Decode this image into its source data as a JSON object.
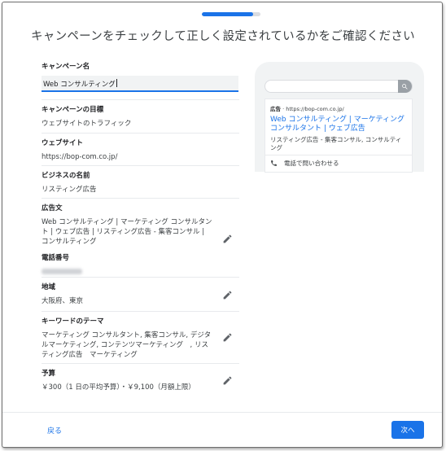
{
  "progress": {
    "completed_fraction": 0.88
  },
  "page_title": "キャンペーンをチェックして正しく設定されているかをご確認ください",
  "campaign_name": {
    "label": "キャンペーン名",
    "value": "Web コンサルティング"
  },
  "sections": {
    "goal": {
      "label": "キャンペーンの目標",
      "value": "ウェブサイトのトラフィック"
    },
    "website": {
      "label": "ウェブサイト",
      "value": "https://bop-com.co.jp/"
    },
    "business_name": {
      "label": "ビジネスの名前",
      "value": "リスティング広告"
    },
    "ad_text": {
      "label": "広告文",
      "value": "Web コンサルティング | マーケティング コンサルタント | ウェブ広告 | リスティング広告 - 集客コンサル | コンサルティング"
    },
    "phone": {
      "label": "電話番号"
    },
    "region": {
      "label": "地域",
      "value": "大阪府、東京"
    },
    "keyword_themes": {
      "label": "キーワードのテーマ",
      "value": "マーケティング コンサルタント, 集客コンサル, デジタルマーケティング, コンテンツマーケティング　, リスティング広告　マーケティング"
    },
    "budget": {
      "label": "予算",
      "value": "￥300（1 日の平均予算）・￥9,100（月額上限）"
    }
  },
  "ad_preview": {
    "ad_badge": "広告",
    "url": "https://bop-com.co.jp/",
    "headline": "Web コンサルティング | マーケティング コンサルタント | ウェブ広告",
    "description": "リスティング広告 - 集客コンサル, コンサルティング",
    "call_label": "電話で問い合わせる"
  },
  "footer": {
    "back_label": "戻る",
    "next_label": "次へ"
  },
  "colors": {
    "accent": "#1a73e8",
    "text": "#202124",
    "muted": "#3c4043",
    "divider": "#e8eaed"
  },
  "icons": {
    "edit": "pencil-icon",
    "search": "search-icon",
    "phone": "phone-icon"
  }
}
